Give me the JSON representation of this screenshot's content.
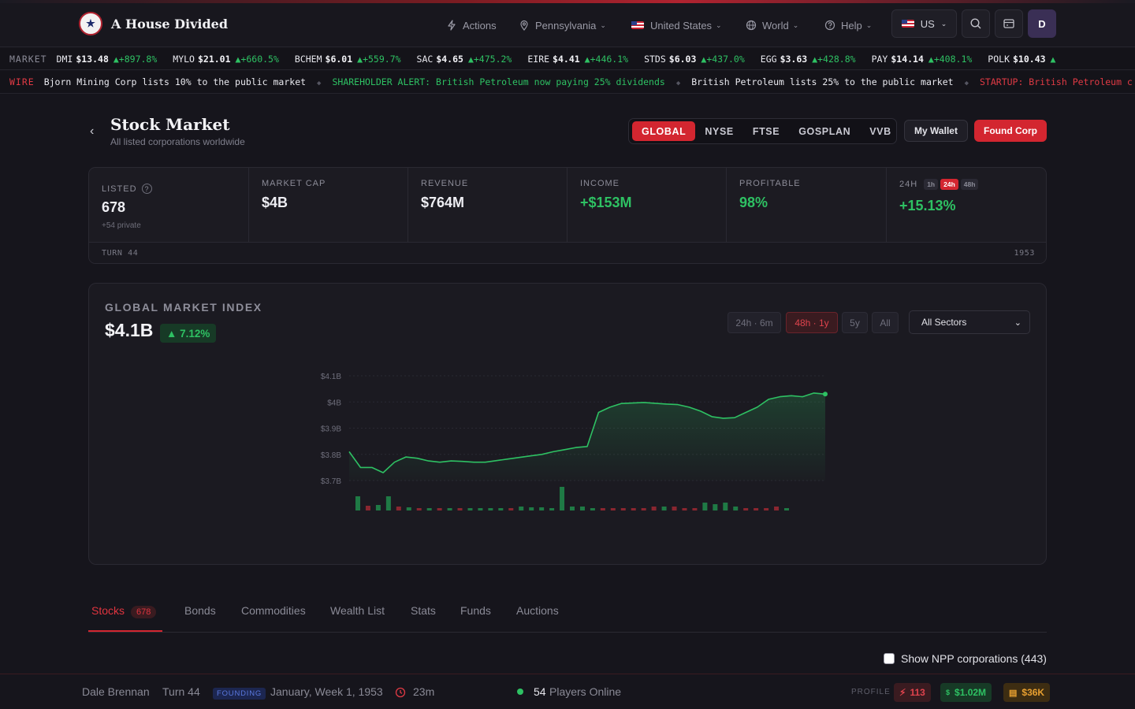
{
  "app": {
    "title": "A House Divided",
    "logo_text": "★"
  },
  "nav": {
    "actions": "Actions",
    "state": "Pennsylvania",
    "country": "United States",
    "world": "World",
    "help": "Help",
    "region_code": "US",
    "avatar_initial": "D"
  },
  "ticker": {
    "label": "MARKET",
    "items": [
      {
        "symbol": "DMI",
        "price": "$13.48",
        "change": "▲+897.8%"
      },
      {
        "symbol": "MYLO",
        "price": "$21.01",
        "change": "▲+660.5%"
      },
      {
        "symbol": "BCHEM",
        "price": "$6.01",
        "change": "▲+559.7%"
      },
      {
        "symbol": "SAC",
        "price": "$4.65",
        "change": "▲+475.2%"
      },
      {
        "symbol": "EIRE",
        "price": "$4.41",
        "change": "▲+446.1%"
      },
      {
        "symbol": "STDS",
        "price": "$6.03",
        "change": "▲+437.0%"
      },
      {
        "symbol": "EGG",
        "price": "$3.63",
        "change": "▲+428.8%"
      },
      {
        "symbol": "PAY",
        "price": "$14.14",
        "change": "▲+408.1%"
      },
      {
        "symbol": "POLK",
        "price": "$10.43",
        "change": "▲"
      }
    ]
  },
  "wire": {
    "label": "WIRE",
    "items": [
      {
        "text": "Bjorn Mining Corp lists 10% to the public market",
        "tone": "w"
      },
      {
        "text": "SHAREHOLDER ALERT: British Petroleum now paying 25% dividends",
        "tone": "g"
      },
      {
        "text": "British Petroleum lists 25% to the public market",
        "tone": "w"
      },
      {
        "text": "STARTUP: British Petroleum c",
        "tone": "r"
      }
    ]
  },
  "page": {
    "title": "Stock Market",
    "subtitle": "All listed corporations worldwide"
  },
  "exchanges": [
    "GLOBAL",
    "NYSE",
    "FTSE",
    "GOSPLAN",
    "VVB"
  ],
  "buttons": {
    "wallet": "My Wallet",
    "found": "Found Corp"
  },
  "stats": {
    "listed_label": "LISTED",
    "listed_value": "678",
    "listed_sub": "+54 private",
    "market_cap_label": "MARKET CAP",
    "market_cap_value": "$4B",
    "revenue_label": "REVENUE",
    "revenue_value": "$764M",
    "income_label": "INCOME",
    "income_value": "+$153M",
    "profitable_label": "PROFITABLE",
    "profitable_value": "98%",
    "change_label": "24H",
    "change_pills": [
      "1h",
      "24h",
      "48h"
    ],
    "change_value": "+15.13%",
    "turn": "TURN 44",
    "year": "1953"
  },
  "index": {
    "label": "GLOBAL MARKET INDEX",
    "value": "$4.1B",
    "change": "▲ 7.12%",
    "ranges": [
      "24h · 6m",
      "48h · 1y",
      "5y",
      "All"
    ],
    "sector": "All Sectors"
  },
  "chart_data": {
    "type": "line",
    "yticks": [
      "$4.1B",
      "$4B",
      "$3.9B",
      "$3.8B",
      "$3.7B"
    ],
    "ylim": [
      3.7,
      4.1
    ],
    "line_color": "#2ec163",
    "values": [
      3.81,
      3.75,
      3.75,
      3.73,
      3.77,
      3.79,
      3.785,
      3.775,
      3.77,
      3.775,
      3.773,
      3.77,
      3.77,
      3.776,
      3.782,
      3.788,
      3.794,
      3.8,
      3.81,
      3.818,
      3.826,
      3.83,
      3.96,
      3.98,
      3.994,
      3.996,
      3.998,
      3.995,
      3.992,
      3.99,
      3.98,
      3.965,
      3.944,
      3.938,
      3.94,
      3.96,
      3.98,
      4.01,
      4.02,
      4.024,
      4.02,
      4.034,
      4.03
    ],
    "volume": [
      18,
      -6,
      7,
      18,
      -5,
      4,
      -3,
      3,
      -3,
      3,
      -3,
      3,
      3,
      3,
      3,
      -3,
      5,
      4,
      4,
      3,
      30,
      5,
      5,
      3,
      -3,
      -3,
      -3,
      -3,
      -3,
      -5,
      5,
      -5,
      -3,
      -3,
      10,
      8,
      10,
      5,
      -3,
      -3,
      -3,
      -5,
      3
    ]
  },
  "tabs": {
    "items": [
      "Stocks",
      "Bonds",
      "Commodities",
      "Wealth List",
      "Stats",
      "Funds",
      "Auctions"
    ],
    "stocks_count": "678"
  },
  "filter": {
    "npp_label": "Show NPP corporations (443)"
  },
  "footer": {
    "player": "Dale Brennan",
    "turn": "Turn 44",
    "phase": "FOUNDING",
    "date": "January, Week 1, 1953",
    "timer": "23m",
    "online_count": "54",
    "online_label": "Players Online",
    "profile_label": "PROFILE",
    "stat_red": "113",
    "stat_green": "$1.02M",
    "stat_gold": "$36K"
  },
  "colors": {
    "accent": "#d32630",
    "positive": "#2ec163",
    "negative": "#e03a44"
  }
}
